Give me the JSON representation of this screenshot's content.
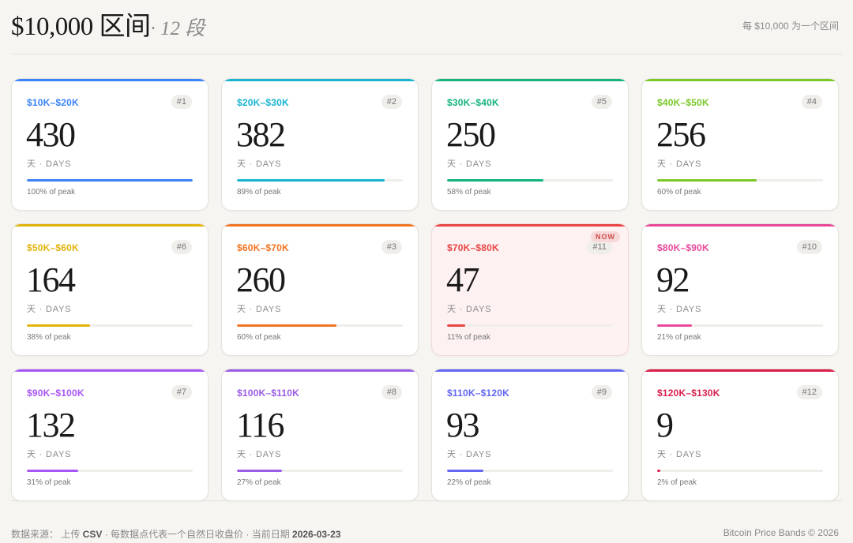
{
  "header": {
    "title": "$10,000 区间",
    "subtitle": "· 12 段",
    "hint": "每 $10,000 为一个区间"
  },
  "unit_label": "天 · DAYS",
  "now_badge": "NOW",
  "cards": [
    {
      "range": "$10K–$20K",
      "rank": "#1",
      "days": "430",
      "peak_pct": 100,
      "peak_label": "100% of peak",
      "color": "#3b82f6",
      "current": false
    },
    {
      "range": "$20K–$30K",
      "rank": "#2",
      "days": "382",
      "peak_pct": 89,
      "peak_label": "89% of peak",
      "color": "#17b3cf",
      "current": false
    },
    {
      "range": "$30K–$40K",
      "rank": "#5",
      "days": "250",
      "peak_pct": 58,
      "peak_label": "58% of peak",
      "color": "#14b37d",
      "current": false
    },
    {
      "range": "$40K–$50K",
      "rank": "#4",
      "days": "256",
      "peak_pct": 60,
      "peak_label": "60% of peak",
      "color": "#7ac728",
      "current": false
    },
    {
      "range": "$50K–$60K",
      "rank": "#6",
      "days": "164",
      "peak_pct": 38,
      "peak_label": "38% of peak",
      "color": "#e2b30b",
      "current": false
    },
    {
      "range": "$60K–$70K",
      "rank": "#3",
      "days": "260",
      "peak_pct": 60,
      "peak_label": "60% of peak",
      "color": "#f27321",
      "current": false
    },
    {
      "range": "$70K–$80K",
      "rank": "#11",
      "days": "47",
      "peak_pct": 11,
      "peak_label": "11% of peak",
      "color": "#e84545",
      "current": true
    },
    {
      "range": "$80K–$90K",
      "rank": "#10",
      "days": "92",
      "peak_pct": 21,
      "peak_label": "21% of peak",
      "color": "#e8479a",
      "current": false
    },
    {
      "range": "$90K–$100K",
      "rank": "#7",
      "days": "132",
      "peak_pct": 31,
      "peak_label": "31% of peak",
      "color": "#a855f7",
      "current": false
    },
    {
      "range": "$100K–$110K",
      "rank": "#8",
      "days": "116",
      "peak_pct": 27,
      "peak_label": "27% of peak",
      "color": "#9b5ce6",
      "current": false
    },
    {
      "range": "$110K–$120K",
      "rank": "#9",
      "days": "93",
      "peak_pct": 22,
      "peak_label": "22% of peak",
      "color": "#6366f1",
      "current": false
    },
    {
      "range": "$120K–$130K",
      "rank": "#12",
      "days": "9",
      "peak_pct": 2,
      "peak_label": "2% of peak",
      "color": "#d81e4b",
      "current": false
    }
  ],
  "footer": {
    "source_prefix": "数据来源： 上传 ",
    "source_csv": "CSV",
    "source_mid": " · 每数据点代表一个自然日收盘价 · 当前日期 ",
    "current_date": "2026-03-23",
    "brand": "Bitcoin Price Bands © 2026"
  }
}
